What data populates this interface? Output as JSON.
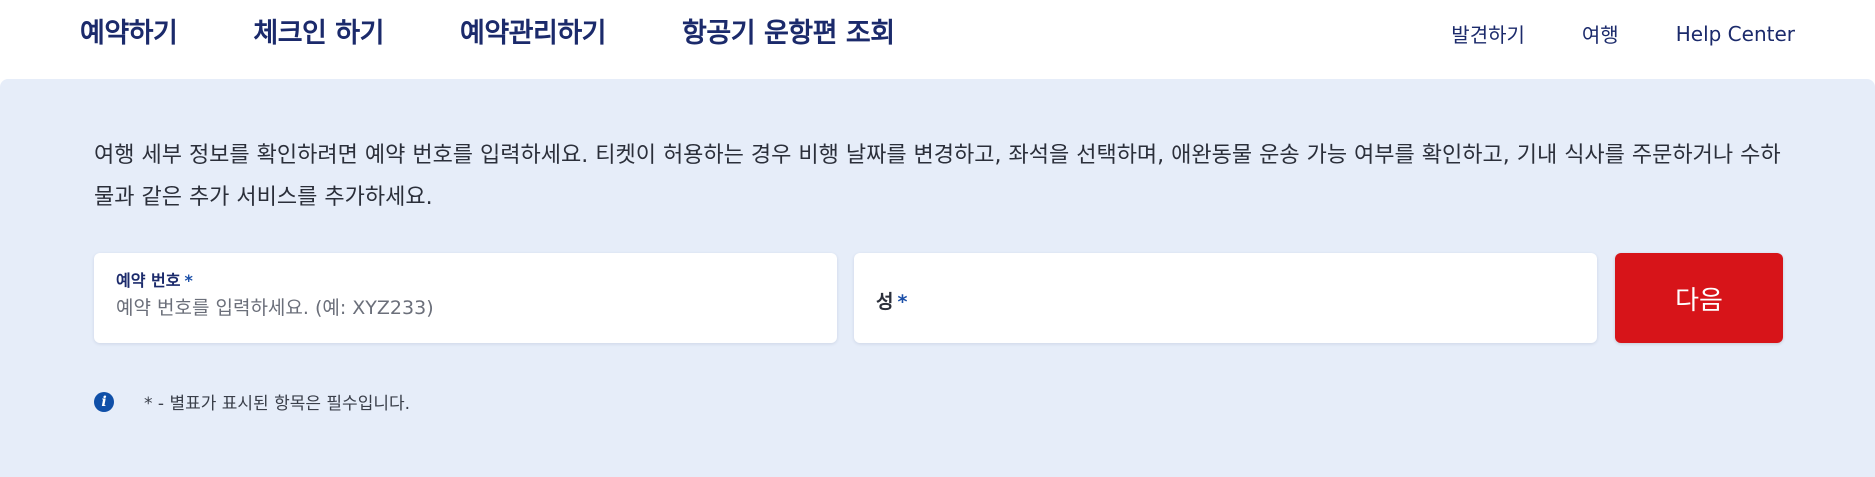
{
  "header": {
    "main_nav": [
      {
        "label": "예약하기"
      },
      {
        "label": "체크인 하기"
      },
      {
        "label": "예약관리하기"
      },
      {
        "label": "항공기 운항편 조회"
      }
    ],
    "utility_nav": [
      {
        "label": "발견하기"
      },
      {
        "label": "여행"
      },
      {
        "label": "Help Center"
      }
    ]
  },
  "form": {
    "description": "여행 세부 정보를 확인하려면 예약 번호를 입력하세요. 티켓이 허용하는 경우 비행 날짜를 변경하고, 좌석을 선택하며, 애완동물 운송 가능 여부를 확인하고, 기내 식사를 주문하거나 수하물과 같은 추가 서비스를 추가하세요.",
    "booking_number": {
      "label": "예약 번호",
      "required_mark": "*",
      "value": "",
      "placeholder": "예약 번호를 입력하세요. (예: XYZ233)"
    },
    "last_name": {
      "label": "성",
      "required_mark": "*",
      "value": ""
    },
    "next_label": "다음",
    "required_note": "* - 별표가 표시된 항목은 필수입니다.",
    "info_icon_glyph": "i"
  },
  "colors": {
    "brand_navy": "#1b2a6b",
    "panel_bg": "#e6edf9",
    "primary_red": "#d71419",
    "info_blue": "#0f4fa8"
  }
}
